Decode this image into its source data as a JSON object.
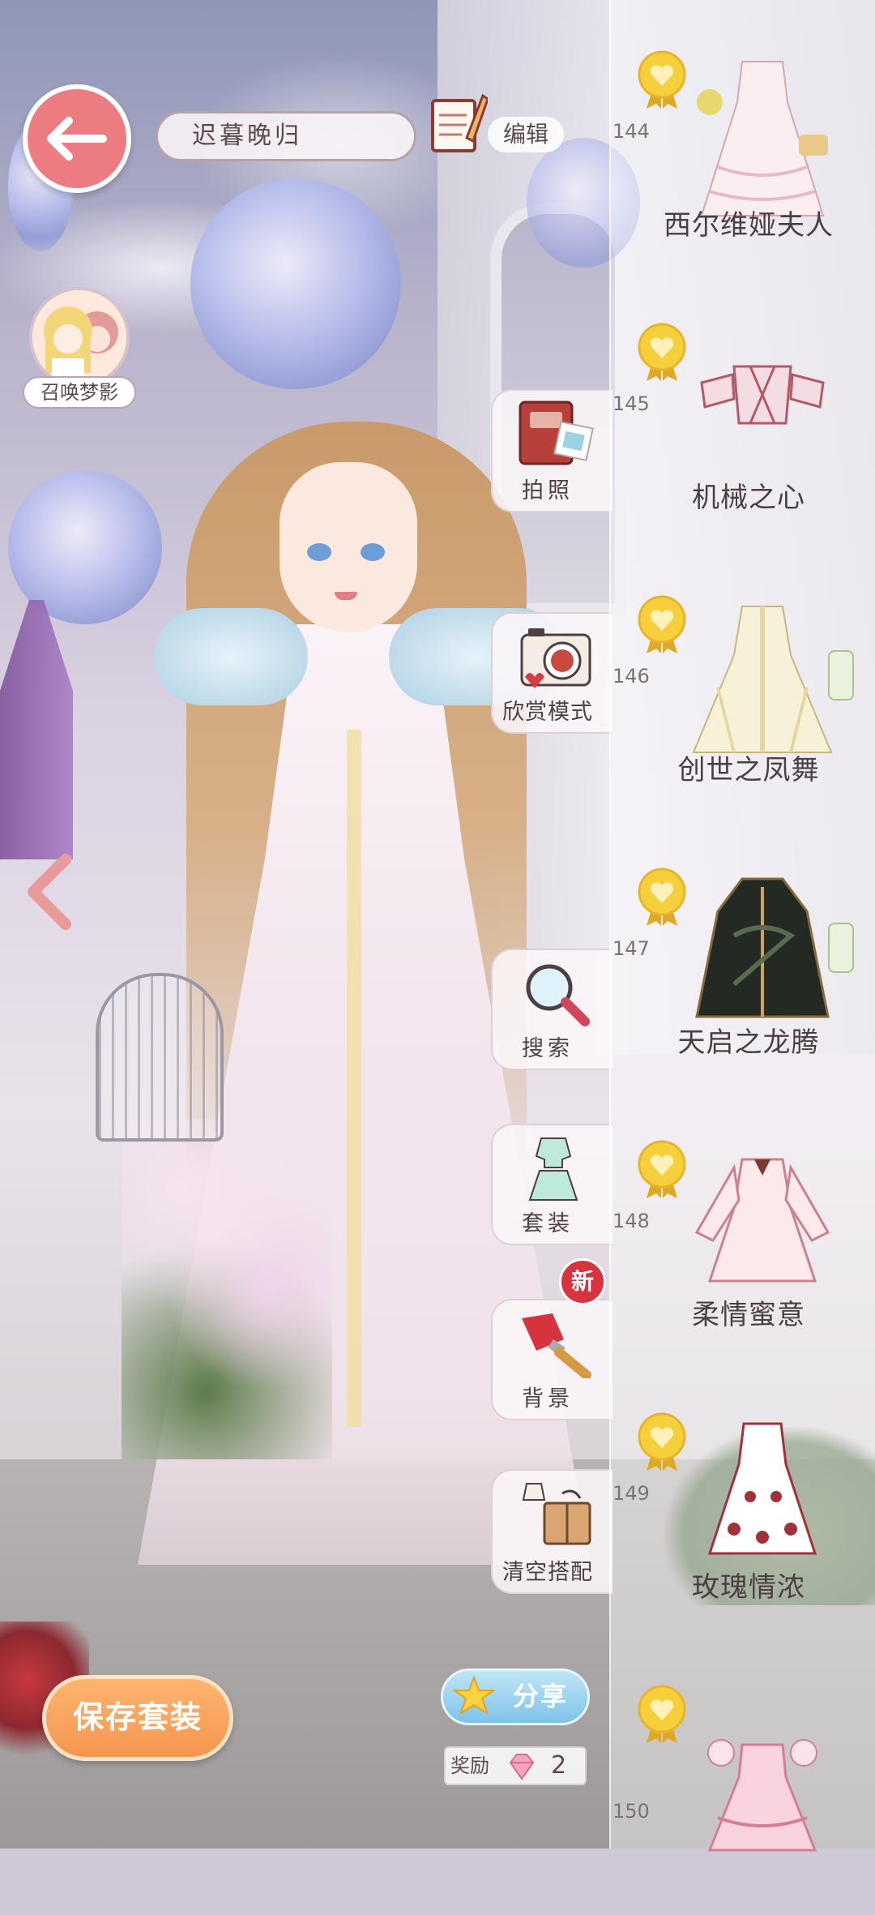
{
  "header": {
    "outfit_name": "迟暮晚归",
    "edit_label": "编辑"
  },
  "summon": {
    "label": "召唤梦影"
  },
  "tools": [
    {
      "label": "拍照",
      "icon": "photo-album-icon"
    },
    {
      "label": "欣赏模式",
      "icon": "camera-icon"
    },
    {
      "label": "搜索",
      "icon": "magnifier-icon"
    },
    {
      "label": "套装",
      "icon": "outfit-icon"
    },
    {
      "label": "背景",
      "icon": "paintbrush-icon"
    },
    {
      "label": "清空搭配",
      "icon": "box-icon"
    }
  ],
  "badges": {
    "new": "新"
  },
  "items": [
    {
      "number": "144",
      "name": "西尔维娅夫人"
    },
    {
      "number": "145",
      "name": "机械之心"
    },
    {
      "number": "146",
      "name": "创世之凤舞"
    },
    {
      "number": "147",
      "name": "天启之龙腾"
    },
    {
      "number": "148",
      "name": "柔情蜜意"
    },
    {
      "number": "149",
      "name": "玫瑰情浓"
    },
    {
      "number": "150",
      "name": ""
    }
  ],
  "actions": {
    "save_label": "保存套装",
    "share_label": "分享",
    "reward_label": "奖励",
    "reward_count": "2"
  },
  "colors": {
    "back_button": "#ec7c82",
    "save_button": "#f49550",
    "share_button": "#7ec3e8",
    "new_badge": "#d9333f",
    "medal": "#f2c231"
  }
}
